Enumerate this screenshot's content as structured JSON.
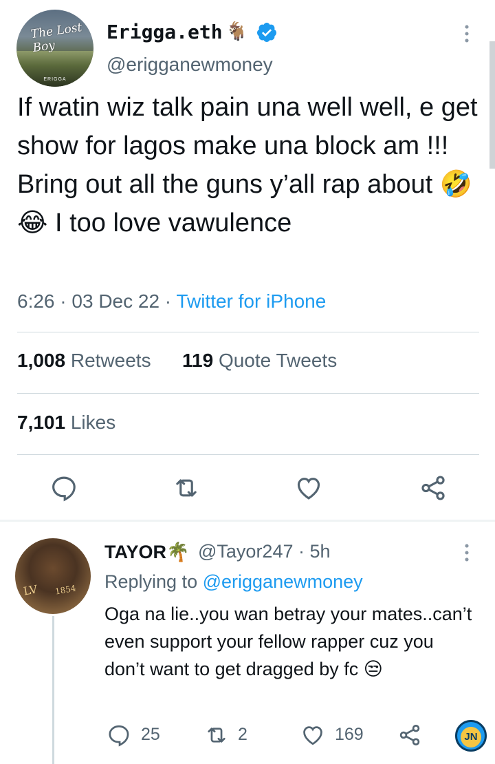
{
  "main_tweet": {
    "display_name": "Erigga.eth",
    "name_emoji": "🐐",
    "handle": "@erigganewmoney",
    "avatar_title": "The Lost Boy",
    "avatar_caption": "ERIGGA",
    "text": "If watin wiz talk pain una well well, e get show for lagos make una block am !!! Bring out all the guns y’all rap about 🤣😂 I too love vawulence",
    "time": "6:26",
    "date": "03 Dec 22",
    "source": "Twitter for iPhone",
    "retweets_count": "1,008",
    "retweets_label": "Retweets",
    "quotes_count": "119",
    "quotes_label": "Quote Tweets",
    "likes_count": "7,101",
    "likes_label": "Likes",
    "icons": [
      "reply-icon",
      "retweet-icon",
      "like-icon",
      "share-icon"
    ]
  },
  "reply": {
    "display_name": "TAYOR🌴",
    "handle_time": "@Tayor247 · 5h",
    "replying_prefix": "Replying to",
    "replying_to": "@erigganewmoney",
    "text": "Oga na lie..you wan betray your mates..can’t even support your fellow rapper cuz you don’t want to get dragged by fc 😒",
    "avatar_lv": "LV",
    "avatar_num": "1854",
    "reply_count": "25",
    "retweet_count": "2",
    "like_count": "169"
  },
  "watermark": "JN",
  "colors": {
    "text": "#0f1419",
    "secondary": "#536471",
    "accent": "#1d9bf0",
    "divider": "#cfd9de"
  }
}
